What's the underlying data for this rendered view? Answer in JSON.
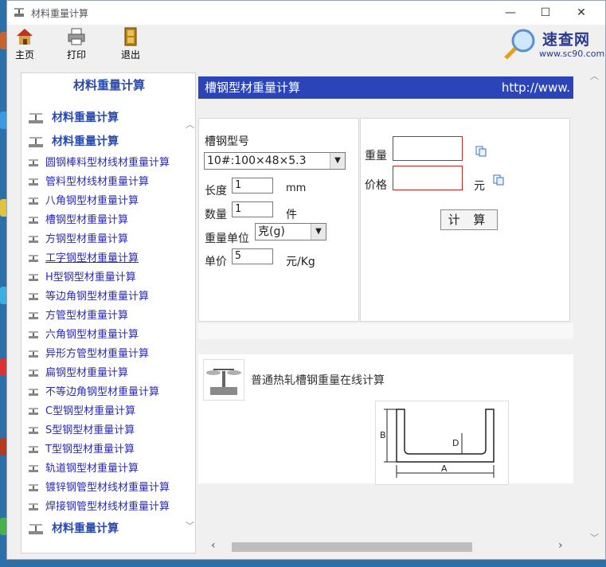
{
  "window": {
    "title": "材料重量计算"
  },
  "window_controls": {
    "minimize": "—",
    "maximize": "☐",
    "close": "✕"
  },
  "toolbar": {
    "home": "主页",
    "print": "打印",
    "exit": "退出"
  },
  "logo": {
    "name": "速查网",
    "url": "www.sc90.com"
  },
  "sidebar": {
    "title": "材料重量计算",
    "head_top_1": "材料重量计算",
    "head_top_2": "材料重量计算",
    "head_bottom": "材料重量计算",
    "items": [
      "圆钢棒料型材线材重量计算",
      "管料型材线材重量计算",
      "八角钢型材重量计算",
      "槽钢型材重量计算",
      "方钢型材重量计算",
      "工字钢型材重量计算",
      "H型钢型材重量计算",
      "等边角钢型材重量计算",
      "方管型材重量计算",
      "六角钢型材重量计算",
      "异形方管型材重量计算",
      "扁钢型材重量计算",
      "不等边角钢型材重量计算",
      "C型钢型材重量计算",
      "S型钢型材重量计算",
      "T型钢型材重量计算",
      "轨道钢型材重量计算",
      "镀锌钢管型材线材重量计算",
      "焊接钢管型材线材重量计算"
    ]
  },
  "main": {
    "header_title": "槽钢型材重量计算",
    "header_url": "http://www.",
    "form": {
      "model_label": "槽钢型号",
      "model_value": "10#:100×48×5.3",
      "length_label": "长度",
      "length_value": "1",
      "length_unit": "mm",
      "qty_label": "数量",
      "qty_value": "1",
      "qty_unit": "件",
      "weight_unit_label": "重量单位",
      "weight_unit_value": "克(g)",
      "price_label": "单价",
      "price_value": "5",
      "price_unit": "元/Kg"
    },
    "result": {
      "weight_label": "重量",
      "weight_value": "",
      "price_label": "价格",
      "price_value": "",
      "price_unit": "元",
      "calc_button": "计 算"
    },
    "description": "普通热轧槽钢重量在线计算",
    "diagram_labels": {
      "b": "B",
      "d": "D",
      "a": "A"
    }
  }
}
